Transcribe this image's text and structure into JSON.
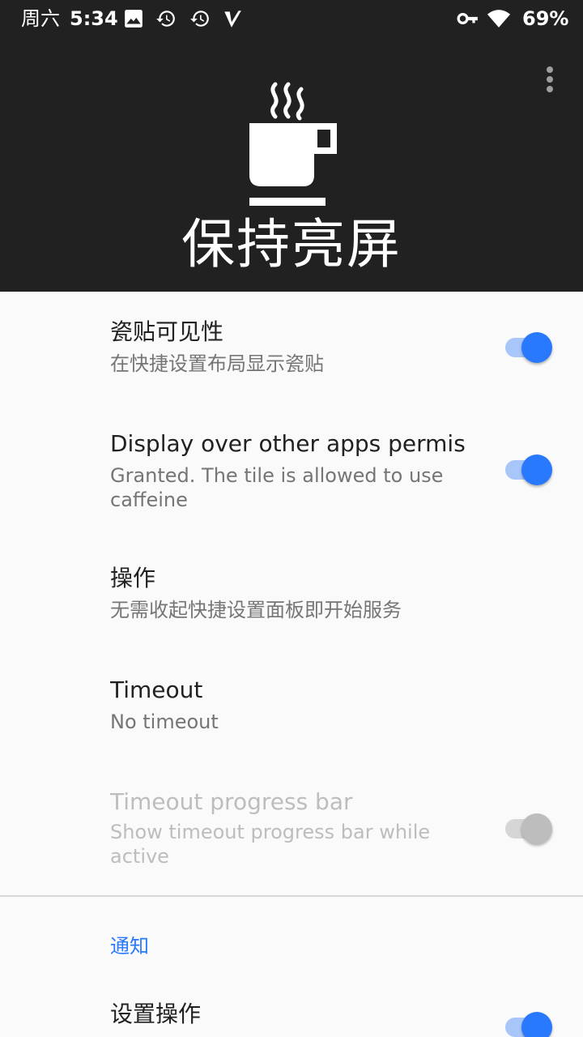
{
  "status_bar": {
    "day": "周六",
    "time": "5:34",
    "battery": "69%",
    "icons": [
      "image-icon",
      "history-icon",
      "history-icon",
      "app-v-icon",
      "vpn-key-icon",
      "wifi-icon"
    ]
  },
  "header": {
    "title": "保持亮屏",
    "logo": "coffee-cup-icon",
    "menu": "more-vert-icon"
  },
  "prefs": [
    {
      "title": "瓷贴可见性",
      "summary": "在快捷设置布局显示瓷贴",
      "switch": true,
      "enabled": true
    },
    {
      "title": "Display over other apps permiss..",
      "summary": "Granted. The tile is allowed to use caffeine",
      "switch": true,
      "enabled": true
    },
    {
      "title": "操作",
      "summary": "无需收起快捷设置面板即开始服务"
    },
    {
      "title": "Timeout",
      "summary": "No timeout"
    },
    {
      "title": "Timeout progress bar",
      "summary": "Show timeout progress bar while active",
      "switch": false,
      "enabled": false
    }
  ],
  "notification_category": "通知",
  "notification_pref": {
    "title": "设置操作",
    "switch": true
  },
  "colors": {
    "accent": "#2979ff",
    "header_bg": "#212121",
    "background": "#fafafa"
  }
}
